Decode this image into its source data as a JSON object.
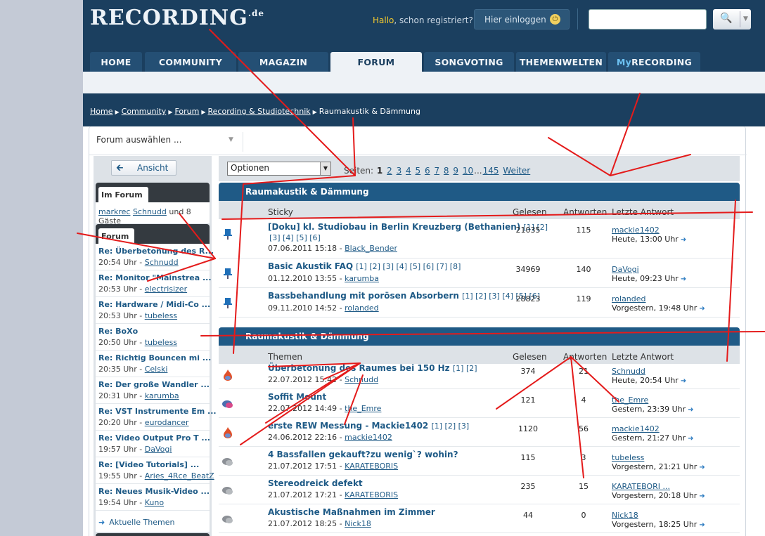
{
  "header": {
    "logo_main": "RECORDING",
    "logo_tld": ".de",
    "greeting_hallo": "Hallo",
    "greeting_rest": ", schon registriert?",
    "login_label": "Hier einloggen",
    "search_placeholder": ""
  },
  "nav": {
    "tabs": [
      {
        "label": "HOME"
      },
      {
        "label": "COMMUNITY"
      },
      {
        "label": "MAGAZIN"
      },
      {
        "label": "FORUM",
        "active": true
      },
      {
        "label": "SONGVOTING"
      },
      {
        "label": "THEMENWELTEN"
      },
      {
        "label_prefix": "My",
        "label": "RECORDING"
      }
    ]
  },
  "breadcrumb": [
    "Home",
    "Community",
    "Forum",
    "Recording & Studiotechnik",
    "Raumakustik & Dämmung"
  ],
  "forum_select": {
    "label": "Forum auswählen ..."
  },
  "sidebar": {
    "ansicht_label": "Ansicht",
    "im_forum_tab": "Im Forum",
    "online_user1": "markrec",
    "online_user2": "Schnudd",
    "online_rest": " und 8 Gäste",
    "forum_tab": "Forum",
    "items": [
      {
        "title": "Re: Überbetonung des R...",
        "time": "20:54 Uhr - ",
        "user": "Schnudd"
      },
      {
        "title": "Re: Monitor \"Mainstrea ...",
        "time": "20:53 Uhr - ",
        "user": "electrisizer"
      },
      {
        "title": "Re: Hardware / Midi-Co ...",
        "time": "20:53 Uhr - ",
        "user": "tubeless"
      },
      {
        "title": "Re: BoXo",
        "time": "20:50 Uhr - ",
        "user": "tubeless"
      },
      {
        "title": "Re: Richtig Bouncen mi ...",
        "time": "20:35 Uhr - ",
        "user": "Celski"
      },
      {
        "title": "Re: Der große Wandler ...",
        "time": "20:31 Uhr - ",
        "user": "karumba"
      },
      {
        "title": "Re: VST Instrumente Em ...",
        "time": "20:20 Uhr - ",
        "user": "eurodancer"
      },
      {
        "title": "Re: Video Output Pro T ...",
        "time": "19:57 Uhr - ",
        "user": "DaVogi"
      },
      {
        "title": "Re: [Video Tutorials] ...",
        "time": "19:55 Uhr - ",
        "user": "Aries_4Rce_BeatZ"
      },
      {
        "title": "Re: Neues Musik-Video ...",
        "time": "19:54 Uhr - ",
        "user": "Kuno"
      }
    ],
    "aktuelle_label": "Aktuelle Themen"
  },
  "main": {
    "options_label": "Optionen",
    "pager_label": "Seiten:",
    "pager_current": "1",
    "pager_pages": [
      "2",
      "3",
      "4",
      "5",
      "6",
      "7",
      "8",
      "9",
      "10"
    ],
    "pager_ellipsis": "...",
    "pager_last": "145",
    "pager_next": "Weiter",
    "section1_title": "Raumakustik & Dämmung",
    "sticky_cols": {
      "topic": "Sticky",
      "gelesen": "Gelesen",
      "antworten": "Antworten",
      "letzte": "Letzte Antwort"
    },
    "sticky": [
      {
        "title": "[Doku] kl. Studiobau in Berlin Kreuzberg (Bethanien)",
        "pages1": "[1] [2]",
        "pages2": "[3] [4] [5] [6]",
        "date": "07.06.2011 15:18 - ",
        "author": "Black_Bender",
        "gelesen": "21035",
        "antworten": "115",
        "last_user": "mackie1402",
        "last_time": "Heute, 13:00 Uhr"
      },
      {
        "title": "Basic Akustik FAQ",
        "pages1": "[1] [2] [3] [4] [5] [6] [7] [8]",
        "date": "01.12.2010 13:55 - ",
        "author": "karumba",
        "gelesen": "34969",
        "antworten": "140",
        "last_user": "DaVogi",
        "last_time": "Heute, 09:23 Uhr"
      },
      {
        "title": "Bassbehandlung mit porösen Absorbern",
        "pages1": "[1] [2] [3] [4] [5] [6]",
        "date": "09.11.2010 14:52 - ",
        "author": "rolanded",
        "gelesen": "28823",
        "antworten": "119",
        "last_user": "rolanded",
        "last_time": "Vorgestern, 19:48 Uhr"
      }
    ],
    "section2_title": "Raumakustik & Dämmung",
    "topic_cols": {
      "topic": "Themen",
      "gelesen": "Gelesen",
      "antworten": "Antworten",
      "letzte": "Letzte Antwort"
    },
    "topics": [
      {
        "icon": "hot",
        "title": "Überbetonung des Raumes bei 150 Hz",
        "pages1": "[1] [2]",
        "date": "22.07.2012 15:42 - ",
        "author": "Schnudd",
        "gelesen": "374",
        "antworten": "21",
        "last_user": "Schnudd",
        "last_time": "Heute, 20:54 Uhr"
      },
      {
        "icon": "new",
        "title": "Soffit Mount",
        "pages1": "",
        "date": "22.07.2012 14:49 - ",
        "author": "the_Emre",
        "gelesen": "121",
        "antworten": "4",
        "last_user": "the_Emre",
        "last_time": "Gestern, 23:39 Uhr"
      },
      {
        "icon": "hot",
        "title": "erste REW Messung - Mackie1402",
        "pages1": "[1] [2] [3]",
        "date": "24.06.2012 22:16 - ",
        "author": "mackie1402",
        "gelesen": "1120",
        "antworten": "56",
        "last_user": "mackie1402",
        "last_time": "Gestern, 21:27 Uhr"
      },
      {
        "icon": "normal",
        "title": "4 Bassfallen gekauft?zu wenig`? wohin?",
        "pages1": "",
        "date": "21.07.2012 17:51 - ",
        "author": "KARATEBORIS",
        "gelesen": "115",
        "antworten": "3",
        "last_user": "tubeless",
        "last_time": "Vorgestern, 21:21 Uhr"
      },
      {
        "icon": "normal",
        "title": "Stereodreick defekt",
        "pages1": "",
        "date": "21.07.2012 17:21 - ",
        "author": "KARATEBORIS",
        "gelesen": "235",
        "antworten": "15",
        "last_user": "KARATEBORI ...",
        "last_time": "Vorgestern, 20:18 Uhr"
      },
      {
        "icon": "normal",
        "title": "Akustische Maßnahmen im Zimmer",
        "pages1": "",
        "date": "21.07.2012 18:25 - ",
        "author": "Nick18",
        "gelesen": "44",
        "antworten": "0",
        "last_user": "Nick18",
        "last_time": "Vorgestern, 18:25 Uhr"
      }
    ]
  },
  "colors": {
    "header_bg": "#1b3f5f",
    "section_blue": "#1f5a86",
    "link": "#1e5a86",
    "annotation_red": "#e41b1b",
    "greeting_yellow": "#f3c92e"
  }
}
